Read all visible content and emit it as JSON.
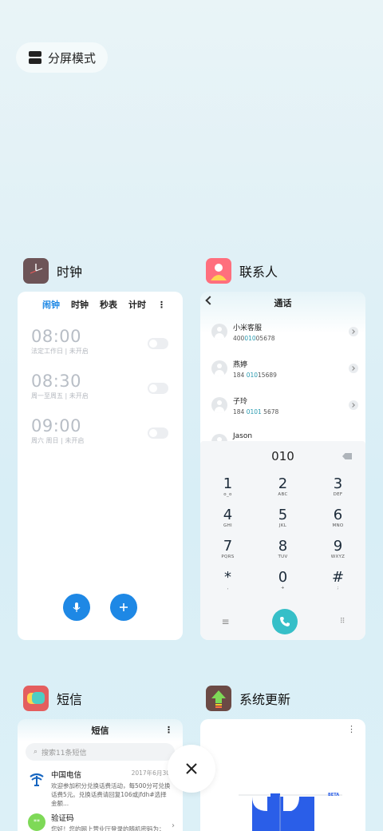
{
  "split_mode": {
    "label": "分屏模式"
  },
  "apps": {
    "clock": {
      "name": "时钟",
      "tabs": [
        "闹钟",
        "时钟",
        "秒表",
        "计时"
      ],
      "alarms": [
        {
          "time": "08:00",
          "desc": "法定工作日 | 未开启"
        },
        {
          "time": "08:30",
          "desc": "周一至周五 | 未开启"
        },
        {
          "time": "09:00",
          "desc": "周六 周日 | 未开启"
        }
      ]
    },
    "contacts": {
      "name": "联系人",
      "title": "通话",
      "entries": [
        {
          "name": "小米客服",
          "num_pre": "400",
          "num_hl": "010",
          "num_post": "05678"
        },
        {
          "name": "燕婷",
          "num_pre": "184 ",
          "num_hl": "010",
          "num_post": "15689"
        },
        {
          "name": "子玲",
          "num_pre": "184 ",
          "num_hl": "0101",
          "num_post": " 5678"
        },
        {
          "name": "Jason",
          "num_pre": "",
          "num_hl": "",
          "num_post": ""
        }
      ],
      "dial_input": "010",
      "keys": [
        {
          "n": "1",
          "l": "o_o"
        },
        {
          "n": "2",
          "l": "ABC"
        },
        {
          "n": "3",
          "l": "DEF"
        },
        {
          "n": "4",
          "l": "GHI"
        },
        {
          "n": "5",
          "l": "JKL"
        },
        {
          "n": "6",
          "l": "MNO"
        },
        {
          "n": "7",
          "l": "PQRS"
        },
        {
          "n": "8",
          "l": "TUV"
        },
        {
          "n": "9",
          "l": "WXYZ"
        },
        {
          "n": "*",
          "l": ","
        },
        {
          "n": "0",
          "l": "+"
        },
        {
          "n": "#",
          "l": ";"
        }
      ]
    },
    "sms": {
      "name": "短信",
      "title": "短信",
      "search_placeholder": "搜索11条短信",
      "messages": [
        {
          "sender": "中国电信",
          "date": "2017年6月30",
          "body": "欢迎参加积分兑换话费活动，每500分可兑换话费5元。兑换话费请回复106或jfdh#选择金额..."
        },
        {
          "sender": "验证码",
          "date": "",
          "body": "您好！您的网上营业厅登录的随机密码为："
        }
      ]
    },
    "update": {
      "name": "系统更新",
      "badge": "BETA"
    }
  },
  "colors": {
    "accent": "#1e88e5",
    "call": "#36bfc8",
    "highlight": "#2a9bb0"
  }
}
